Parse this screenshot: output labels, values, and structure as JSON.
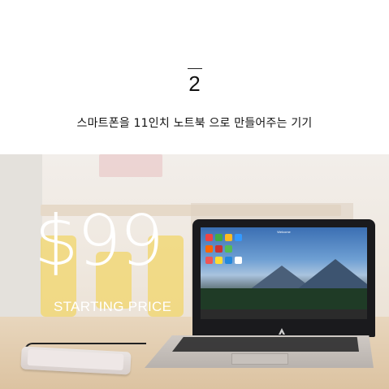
{
  "header": {
    "number": "2",
    "subtitle": "스마트폰을 11인치 노트북 으로 만들어주는 기기"
  },
  "photo": {
    "price": "$99",
    "price_label": "STARTING PRICE",
    "screen_title": "Welcome"
  },
  "colors": {
    "price_text": "#ffffff",
    "heading_text": "#111111"
  },
  "icons": {
    "brand_logo": "triangle-logo-icon"
  }
}
